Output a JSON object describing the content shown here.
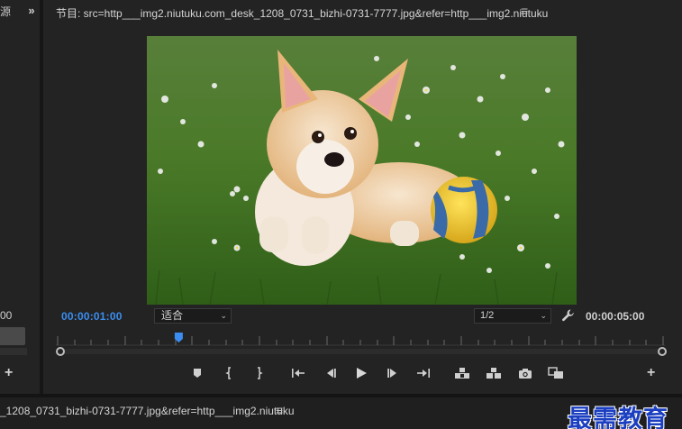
{
  "source_panel": {
    "partial_title": "源",
    "expand_glyph": "»",
    "timecode": "00",
    "add_glyph": "+"
  },
  "program_monitor": {
    "title": "节目: src=http___img2.niutuku.com_desk_1208_0731_bizhi-0731-7777.jpg&refer=http___img2.niutuku",
    "menu_glyph": "≡",
    "playhead_time": "00:00:01:00",
    "fit_select": {
      "value": "适合",
      "chevron": "⌄"
    },
    "resolution_select": {
      "value": "1/2",
      "chevron": "⌄"
    },
    "duration_time": "00:00:05:00",
    "add_glyph": "+",
    "playhead_fraction": 0.2,
    "transport_buttons": [
      "add-marker-icon",
      "mark-in-icon",
      "mark-out-icon",
      "go-to-in-icon",
      "step-back-icon",
      "play-icon",
      "step-forward-icon",
      "go-to-out-icon",
      "lift-icon",
      "extract-icon",
      "export-frame-icon",
      "comparison-view-icon"
    ]
  },
  "timeline_tab": {
    "title": "_1208_0731_bizhi-0731-7777.jpg&refer=http___img2.niutuku",
    "menu_glyph": "≡"
  },
  "watermark": {
    "text": "最需教育"
  },
  "colors": {
    "accent_blue": "#3b8df0",
    "panel_bg": "#232323",
    "watermark_blue": "#1b3fc0"
  }
}
